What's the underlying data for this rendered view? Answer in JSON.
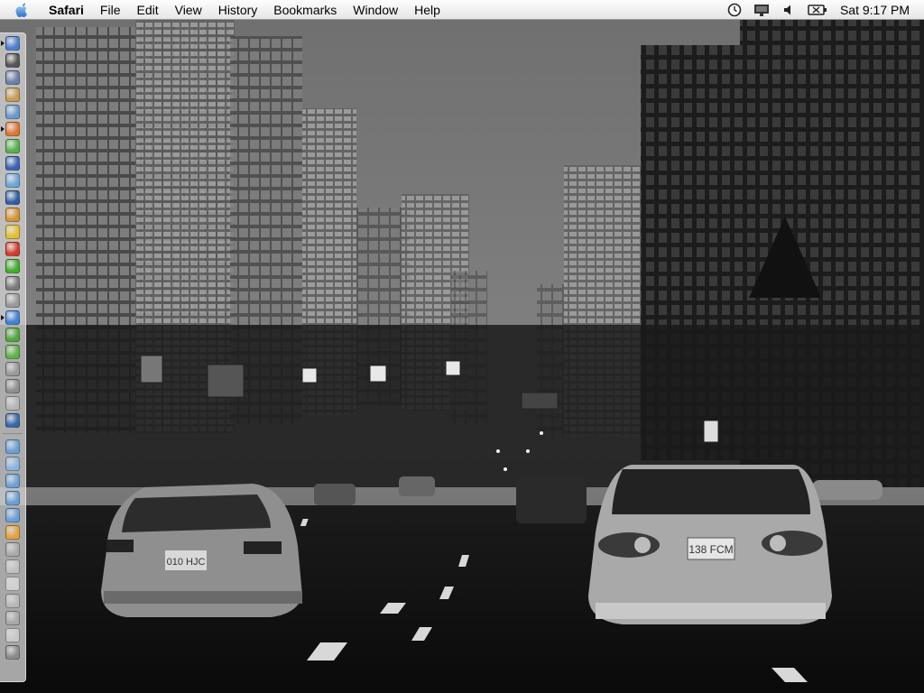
{
  "menubar": {
    "apple_icon": "apple-icon",
    "app_name": "Safari",
    "menus": [
      "File",
      "Edit",
      "View",
      "History",
      "Bookmarks",
      "Window",
      "Help"
    ],
    "status_icons": [
      "time-machine-clock-icon",
      "display-icon",
      "volume-icon",
      "battery-icon"
    ],
    "clock": "Sat 9:17 PM"
  },
  "dock": {
    "apps": [
      {
        "name": "finder",
        "color": "#4a7fd0",
        "icon": "finder-icon",
        "running": true
      },
      {
        "name": "spider",
        "color": "#555555",
        "icon": "spider-icon"
      },
      {
        "name": "preview",
        "color": "#6c7fa8",
        "icon": "preview-icon"
      },
      {
        "name": "address-book",
        "color": "#c79a55",
        "icon": "address-book-icon"
      },
      {
        "name": "network",
        "color": "#6b98c9",
        "icon": "network-icon"
      },
      {
        "name": "firefox",
        "color": "#e0762d",
        "icon": "firefox-icon",
        "running": true
      },
      {
        "name": "itunes",
        "color": "#56b04c",
        "icon": "itunes-icon"
      },
      {
        "name": "frontrow",
        "color": "#3a62b8",
        "icon": "media-icon"
      },
      {
        "name": "mail",
        "color": "#6aa6d9",
        "icon": "mail-icon"
      },
      {
        "name": "quicktime",
        "color": "#2f5fa5",
        "icon": "quicktime-icon"
      },
      {
        "name": "photos",
        "color": "#d8912f",
        "icon": "photo-icon"
      },
      {
        "name": "wallet",
        "color": "#e5c12a",
        "icon": "wallet-icon"
      },
      {
        "name": "flash",
        "color": "#d43b2b",
        "icon": "flash-icon"
      },
      {
        "name": "dreamweaver",
        "color": "#3fae2a",
        "icon": "dreamweaver-icon"
      },
      {
        "name": "image-editor",
        "color": "#7a7a7a",
        "icon": "image-editor-icon"
      },
      {
        "name": "text",
        "color": "#9a9a9a",
        "icon": "text-icon"
      },
      {
        "name": "safari",
        "color": "#3d83d6",
        "icon": "safari-icon",
        "running": true
      },
      {
        "name": "green-app",
        "color": "#4fa83a",
        "icon": "green-app-icon"
      },
      {
        "name": "cube",
        "color": "#5db346",
        "icon": "cube-icon"
      },
      {
        "name": "camera",
        "color": "#999999",
        "icon": "camera-icon"
      },
      {
        "name": "script-editor",
        "color": "#8f8f8f",
        "icon": "script-editor-icon"
      },
      {
        "name": "terminal",
        "color": "#b5b5b5",
        "icon": "terminal-icon"
      },
      {
        "name": "network-utility",
        "color": "#3669a8",
        "icon": "globe-icon"
      }
    ],
    "docs": [
      {
        "name": "folder-1",
        "color": "#6aa0d8",
        "icon": "folder-icon"
      },
      {
        "name": "applications",
        "color": "#8bb3e0",
        "icon": "applications-folder-icon"
      },
      {
        "name": "folder-2",
        "color": "#6aa0d8",
        "icon": "folder-icon"
      },
      {
        "name": "folder-3",
        "color": "#6aa0d8",
        "icon": "folder-icon"
      },
      {
        "name": "folder-4",
        "color": "#6aa0d8",
        "icon": "folder-icon"
      },
      {
        "name": "package",
        "color": "#e6a33a",
        "icon": "package-icon"
      },
      {
        "name": "document-1",
        "color": "#aaaaaa",
        "icon": "document-icon"
      },
      {
        "name": "document-2",
        "color": "#c0c0c0",
        "icon": "document-icon"
      },
      {
        "name": "document-3",
        "color": "#cfcfcf",
        "icon": "document-icon"
      },
      {
        "name": "document-4",
        "color": "#b8b8b8",
        "icon": "document-icon"
      },
      {
        "name": "document-5",
        "color": "#a8a8a8",
        "icon": "document-icon"
      },
      {
        "name": "document-6",
        "color": "#c8c8c8",
        "icon": "document-icon"
      },
      {
        "name": "trash",
        "color": "#8a8a8a",
        "icon": "trash-icon"
      }
    ]
  },
  "wallpaper": {
    "description_colors": {
      "sky": "#7a7a7a",
      "road": "#0e0e0e"
    },
    "car_left_plate": "010 HJC",
    "car_right_plate": "138 FCM"
  }
}
